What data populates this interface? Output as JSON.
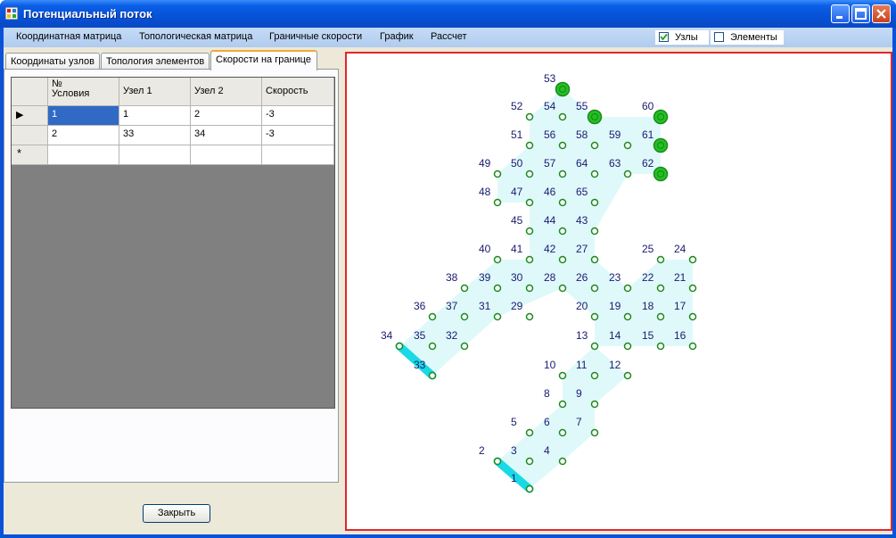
{
  "window": {
    "title": "Потенциальный поток"
  },
  "menu": [
    "Координатная матрица",
    "Топологическая матрица",
    "Граничные скорости",
    "График",
    "Рассчет"
  ],
  "checkboxes": [
    {
      "label": "Узлы",
      "checked": true
    },
    {
      "label": "Элементы",
      "checked": false
    }
  ],
  "tabs": [
    "Координаты узлов",
    "Топология элементов",
    "Скорости на границе"
  ],
  "active_tab": 2,
  "grid": {
    "headers": [
      "№\nУсловия",
      "Узел 1",
      "Узел 2",
      "Скорость"
    ],
    "rows": [
      [
        "1",
        "1",
        "2",
        "-3"
      ],
      [
        "2",
        "33",
        "34",
        "-3"
      ]
    ],
    "new_row_marker": "*",
    "current_row_marker": "▶"
  },
  "close_button": "Закрыть",
  "colors": {
    "accent_border": "#e2262a",
    "mesh_fill": "#dff9fb",
    "boundary": "#19d9e6",
    "node": "#1d8a1d",
    "big_node": "#22c122"
  },
  "node_labels": [
    "1",
    "2",
    "3",
    "4",
    "5",
    "6",
    "7",
    "8",
    "9",
    "10",
    "11",
    "12",
    "13",
    "14",
    "15",
    "16",
    "17",
    "18",
    "19",
    "20",
    "21",
    "22",
    "23",
    "24",
    "25",
    "26",
    "27",
    "28",
    "29",
    "30",
    "31",
    "32",
    "33",
    "34",
    "35",
    "36",
    "37",
    "38",
    "39",
    "40",
    "41",
    "42",
    "43",
    "44",
    "45",
    "46",
    "47",
    "48",
    "49",
    "50",
    "51",
    "52",
    "53",
    "54",
    "55",
    "56",
    "57",
    "58",
    "59",
    "60",
    "61",
    "62",
    "63",
    "64",
    "65"
  ]
}
